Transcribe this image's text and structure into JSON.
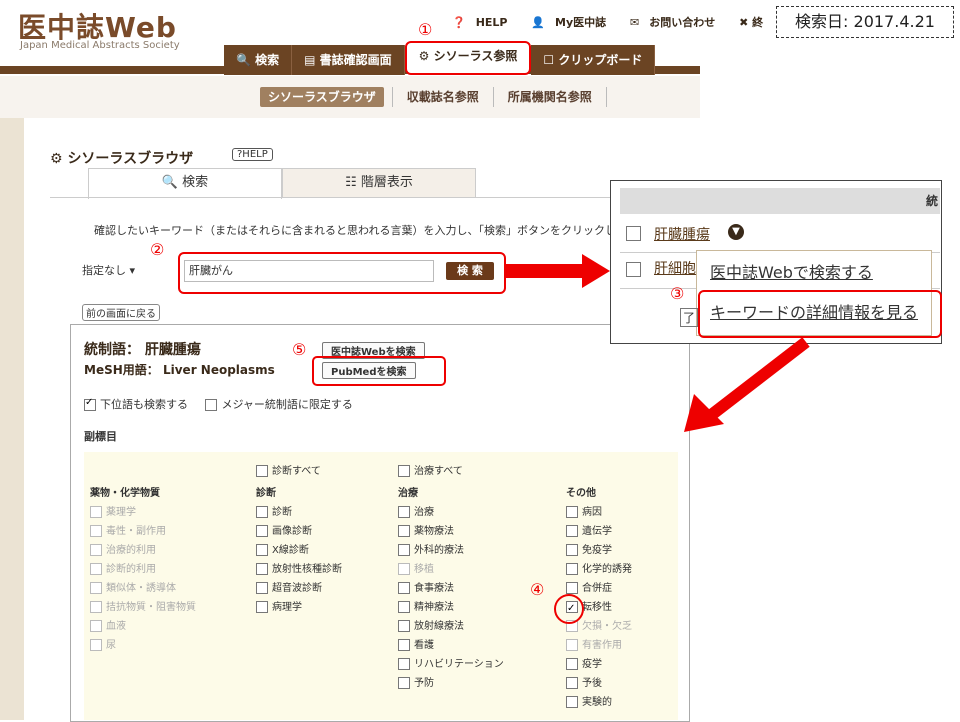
{
  "header": {
    "logo": "医中誌Web",
    "logo_sub": "Japan Medical Abstracts Society",
    "top_links": [
      "HELP",
      "My医中誌",
      "お問い合わせ",
      "✖ 終"
    ],
    "nav_tabs": [
      "検索",
      "書誌確認画面",
      "シソーラス参照",
      "クリップボード"
    ],
    "sub_nav": [
      "シソーラスブラウザ",
      "収載誌名参照",
      "所属機関名参照"
    ]
  },
  "date_label": "検索日: 2017.4.21",
  "browser": {
    "title": "シソーラスブラウザ",
    "help": "?HELP",
    "tab_search": "検索",
    "tab_tree": "階層表示",
    "instruction": "確認したいキーワード（またはそれらに含まれると思われる言葉）を入力し、「検索」ボタンをクリックし",
    "select_value": "指定なし",
    "search_value": "肝臓がん",
    "search_button": "検 索",
    "back_button": "前の画面に戻る"
  },
  "result": {
    "term_label": "統制語：",
    "term": "肝臓腫瘍",
    "mesh_label": "MeSH用語：",
    "mesh": "Liver Neoplasms",
    "btn_ichushi": "医中誌Webを検索",
    "btn_pubmed": "PubMedを検索",
    "chk_lower": "下位語も検索する",
    "chk_major": "メジャー統制語に限定する",
    "subhead_label": "副標目",
    "diag_all": "診断すべて",
    "treat_all": "治療すべて"
  },
  "columns": [
    {
      "head": "薬物・化学物質",
      "items": [
        {
          "t": "薬理学",
          "s": "dis"
        },
        {
          "t": "毒性・副作用",
          "s": "dis"
        },
        {
          "t": "治療的利用",
          "s": "dis"
        },
        {
          "t": "診断的利用",
          "s": "dis"
        },
        {
          "t": "類似体・誘導体",
          "s": "dis"
        },
        {
          "t": "拮抗物質・阻害物質",
          "s": "dis"
        },
        {
          "t": "血液",
          "s": "dis"
        },
        {
          "t": "尿",
          "s": "dis"
        }
      ]
    },
    {
      "head": "診断",
      "items": [
        {
          "t": "診断",
          "s": ""
        },
        {
          "t": "画像診断",
          "s": ""
        },
        {
          "t": "X線診断",
          "s": ""
        },
        {
          "t": "放射性核種診断",
          "s": ""
        },
        {
          "t": "超音波診断",
          "s": ""
        },
        {
          "t": "病理学",
          "s": ""
        }
      ]
    },
    {
      "head": "治療",
      "items": [
        {
          "t": "治療",
          "s": ""
        },
        {
          "t": "薬物療法",
          "s": ""
        },
        {
          "t": "外科的療法",
          "s": ""
        },
        {
          "t": "移植",
          "s": "dis"
        },
        {
          "t": "食事療法",
          "s": ""
        },
        {
          "t": "精神療法",
          "s": ""
        },
        {
          "t": "放射線療法",
          "s": ""
        },
        {
          "t": "看護",
          "s": ""
        },
        {
          "t": "リハビリテーション",
          "s": ""
        },
        {
          "t": "予防",
          "s": ""
        }
      ]
    },
    {
      "head": "その他",
      "items": [
        {
          "t": "病因",
          "s": ""
        },
        {
          "t": "遺伝学",
          "s": ""
        },
        {
          "t": "免疫学",
          "s": ""
        },
        {
          "t": "化学的誘発",
          "s": ""
        },
        {
          "t": "合併症",
          "s": ""
        },
        {
          "t": "転移性",
          "s": "checked"
        },
        {
          "t": "欠損・欠乏",
          "s": "dis"
        },
        {
          "t": "有害作用",
          "s": "dis"
        },
        {
          "t": "疫学",
          "s": ""
        },
        {
          "t": "予後",
          "s": ""
        },
        {
          "t": "実験的",
          "s": ""
        }
      ]
    }
  ],
  "popup": {
    "header_cut": "統",
    "row1": "肝臓腫瘍",
    "row2": "肝細胞",
    "menu1": "医中誌Webで検索する",
    "menu2": "キーワードの詳細情報を見る",
    "row_stub": "了"
  },
  "markers": [
    "①",
    "②",
    "③",
    "④",
    "⑤"
  ],
  "colors": {
    "brown": "#6b4423",
    "red": "#e00000"
  }
}
